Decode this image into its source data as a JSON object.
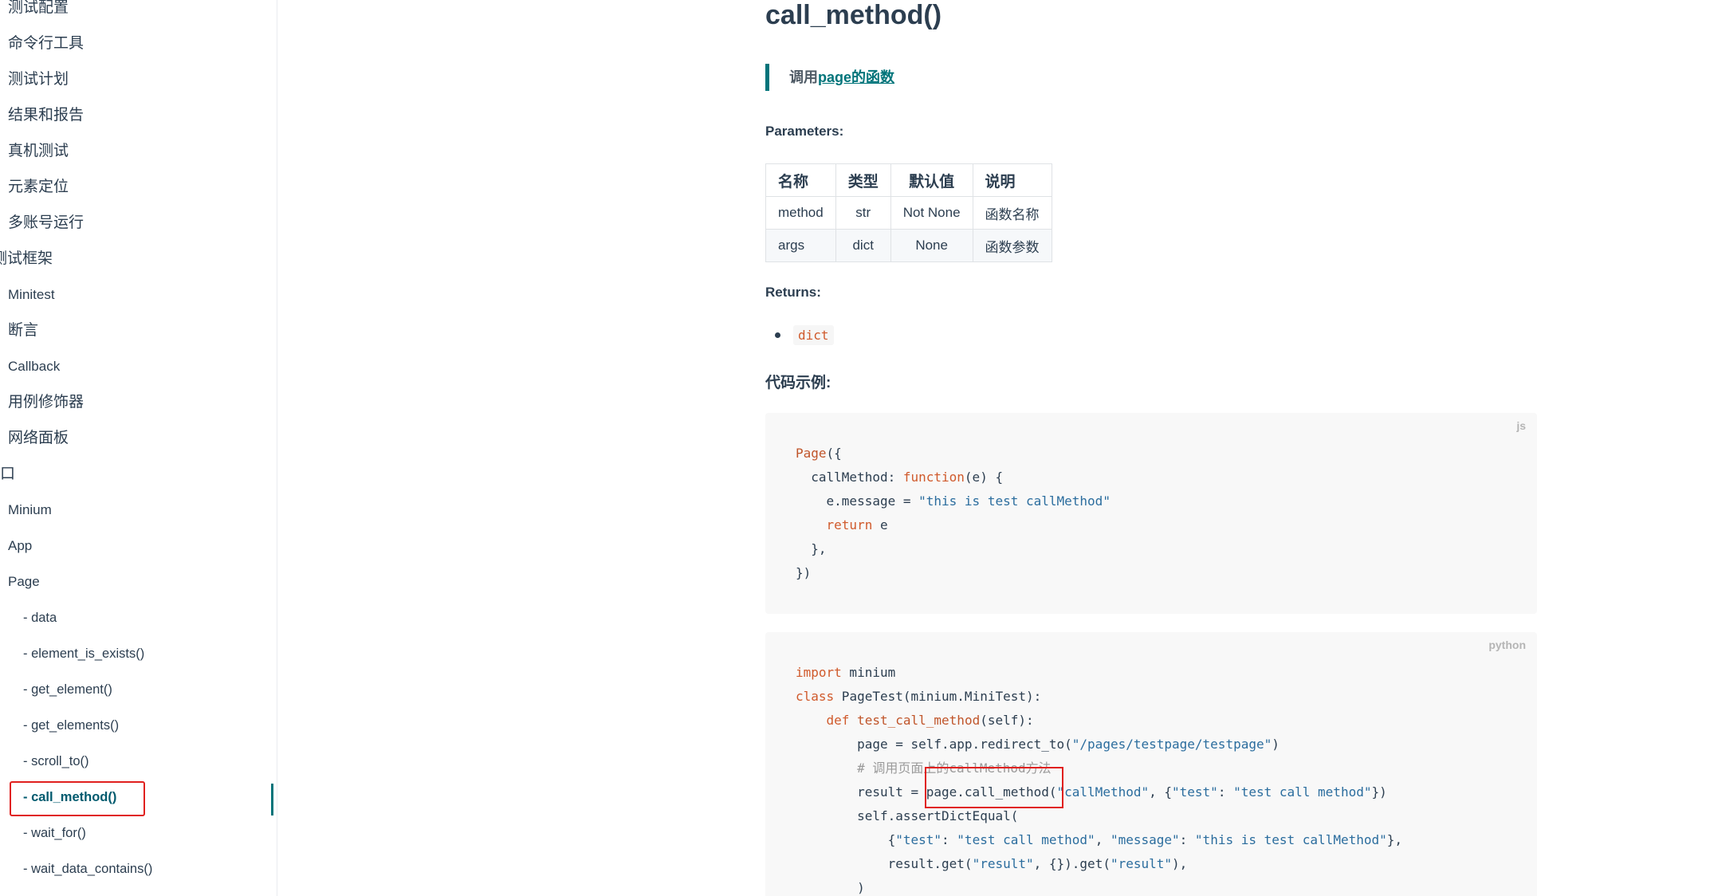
{
  "sidebar": {
    "items": [
      {
        "label": "测试配置"
      },
      {
        "label": "命令行工具"
      },
      {
        "label": "测试计划"
      },
      {
        "label": "结果和报告"
      },
      {
        "label": "真机测试"
      },
      {
        "label": "元素定位"
      },
      {
        "label": "多账号运行"
      },
      {
        "label": "测试框架"
      },
      {
        "label": "Minitest"
      },
      {
        "label": "断言"
      },
      {
        "label": "Callback"
      },
      {
        "label": "用例修饰器"
      },
      {
        "label": "网络面板"
      },
      {
        "label": "接口"
      },
      {
        "label": "Minium"
      },
      {
        "label": "App"
      },
      {
        "label": "Page"
      },
      {
        "label": "- data"
      },
      {
        "label": "- element_is_exists()"
      },
      {
        "label": "- get_element()"
      },
      {
        "label": "- get_elements()"
      },
      {
        "label": "- scroll_to()"
      },
      {
        "label": "- call_method()"
      },
      {
        "label": "- wait_for()"
      },
      {
        "label": "- wait_data_contains()"
      }
    ]
  },
  "content": {
    "title": "call_method()",
    "quote": {
      "prefix": "调用",
      "link": "page的函数"
    },
    "parameters_label": "Parameters:",
    "table": {
      "headers": [
        "名称",
        "类型",
        "默认值",
        "说明"
      ],
      "rows": [
        [
          "method",
          "str",
          "Not None",
          "函数名称"
        ],
        [
          "args",
          "dict",
          "None",
          "函数参数"
        ]
      ]
    },
    "returns_label": "Returns:",
    "returns": [
      "dict"
    ],
    "example_label": "代码示例:",
    "code_blocks": [
      {
        "lang": "js",
        "lines": [
          [
            {
              "t": "Page",
              "c": "fn"
            },
            {
              "t": "({",
              "c": ""
            }
          ],
          [
            {
              "t": "  callMethod: ",
              "c": ""
            },
            {
              "t": "function",
              "c": "kw"
            },
            {
              "t": "(e) {",
              "c": ""
            }
          ],
          [
            {
              "t": "    e.message = ",
              "c": ""
            },
            {
              "t": "\"this is test callMethod\"",
              "c": "str"
            }
          ],
          [
            {
              "t": "    ",
              "c": ""
            },
            {
              "t": "return",
              "c": "kw"
            },
            {
              "t": " e",
              "c": ""
            }
          ],
          [
            {
              "t": "  },",
              "c": ""
            }
          ],
          [
            {
              "t": "})",
              "c": ""
            }
          ]
        ]
      },
      {
        "lang": "python",
        "lines": [
          [
            {
              "t": "import",
              "c": "kw"
            },
            {
              "t": " minium",
              "c": ""
            }
          ],
          [
            {
              "t": "class",
              "c": "kw"
            },
            {
              "t": " PageTest(minium.MiniTest):",
              "c": ""
            }
          ],
          [
            {
              "t": "    ",
              "c": ""
            },
            {
              "t": "def",
              "c": "kw"
            },
            {
              "t": " ",
              "c": ""
            },
            {
              "t": "test_call_method",
              "c": "fn"
            },
            {
              "t": "(self):",
              "c": ""
            }
          ],
          [
            {
              "t": "        page = self.app.redirect_to(",
              "c": ""
            },
            {
              "t": "\"/pages/testpage/testpage\"",
              "c": "str"
            },
            {
              "t": ")",
              "c": ""
            }
          ],
          [
            {
              "t": "        ",
              "c": ""
            },
            {
              "t": "# 调用页面上的callMethod方法",
              "c": "cmt"
            }
          ],
          [
            {
              "t": "        result = page.call_method(",
              "c": ""
            },
            {
              "t": "\"callMethod\"",
              "c": "str"
            },
            {
              "t": ", {",
              "c": ""
            },
            {
              "t": "\"test\"",
              "c": "str"
            },
            {
              "t": ": ",
              "c": ""
            },
            {
              "t": "\"test call method\"",
              "c": "str"
            },
            {
              "t": "})",
              "c": ""
            }
          ],
          [
            {
              "t": "        self.assertDictEqual(",
              "c": ""
            }
          ],
          [
            {
              "t": "            {",
              "c": ""
            },
            {
              "t": "\"test\"",
              "c": "str"
            },
            {
              "t": ": ",
              "c": ""
            },
            {
              "t": "\"test call method\"",
              "c": "str"
            },
            {
              "t": ", ",
              "c": ""
            },
            {
              "t": "\"message\"",
              "c": "str"
            },
            {
              "t": ": ",
              "c": ""
            },
            {
              "t": "\"this is test callMethod\"",
              "c": "str"
            },
            {
              "t": "},",
              "c": ""
            }
          ],
          [
            {
              "t": "            result.get(",
              "c": ""
            },
            {
              "t": "\"result\"",
              "c": "str"
            },
            {
              "t": ", {}).get(",
              "c": ""
            },
            {
              "t": "\"result\"",
              "c": "str"
            },
            {
              "t": "),",
              "c": ""
            }
          ],
          [
            {
              "t": "        )",
              "c": ""
            }
          ]
        ]
      }
    ]
  },
  "colors": {
    "accent": "#00747a",
    "highlight": "#e0201e",
    "code_keyword": "#d05a2c",
    "code_string": "#2b6d9e"
  }
}
